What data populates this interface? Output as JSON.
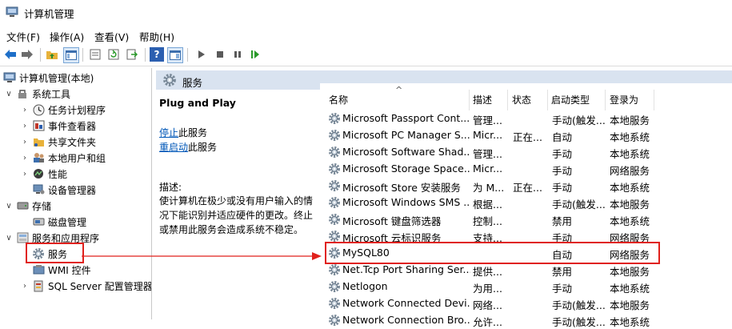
{
  "window": {
    "title": "计算机管理"
  },
  "menu": [
    "文件(F)",
    "操作(A)",
    "查看(V)",
    "帮助(H)"
  ],
  "toolbar_icons": [
    "back-icon",
    "forward-icon",
    "up-folder-icon",
    "show-hide-tree-icon",
    "export-list-icon",
    "refresh-icon",
    "export-icon",
    "help-icon",
    "properties-icon",
    "play-icon",
    "stop-icon",
    "pause-icon",
    "restart-icon"
  ],
  "tree": {
    "root": "计算机管理(本地)",
    "system_tools": "系统工具",
    "task_scheduler": "任务计划程序",
    "event_viewer": "事件查看器",
    "shared_folders": "共享文件夹",
    "local_users": "本地用户和组",
    "performance": "性能",
    "device_manager": "设备管理器",
    "storage": "存储",
    "disk_management": "磁盘管理",
    "services_apps": "服务和应用程序",
    "services": "服务",
    "wmi": "WMI 控件",
    "sql_server": "SQL Server 配置管理器"
  },
  "panel": {
    "title": "服务"
  },
  "extended": {
    "service_name": "Plug and Play",
    "stop_link": "停止",
    "stop_suffix": "此服务",
    "restart_link": "重启动",
    "restart_suffix": "此服务",
    "desc_label": "描述:",
    "desc_line1": "使计算机在极少或没有用户输入的情",
    "desc_line2": "况下能识别并适应硬件的更改。终止",
    "desc_line3": "或禁用此服务会造成系统不稳定。"
  },
  "columns": {
    "name": "名称",
    "desc": "描述",
    "status": "状态",
    "startup": "启动类型",
    "logon": "登录为"
  },
  "services": [
    {
      "name": "Microsoft Passport Cont...",
      "desc": "管理...",
      "status": "",
      "startup": "手动(触发...",
      "logon": "本地服务"
    },
    {
      "name": "Microsoft PC Manager S...",
      "desc": "Micr...",
      "status": "正在...",
      "startup": "自动",
      "logon": "本地系统"
    },
    {
      "name": "Microsoft Software Shad...",
      "desc": "管理...",
      "status": "",
      "startup": "手动",
      "logon": "本地系统"
    },
    {
      "name": "Microsoft Storage Space...",
      "desc": "Micr...",
      "status": "",
      "startup": "手动",
      "logon": "网络服务"
    },
    {
      "name": "Microsoft Store 安装服务",
      "desc": "为 M...",
      "status": "正在...",
      "startup": "手动",
      "logon": "本地系统"
    },
    {
      "name": "Microsoft Windows SMS ...",
      "desc": "根据...",
      "status": "",
      "startup": "手动(触发...",
      "logon": "本地服务"
    },
    {
      "name": "Microsoft 键盘筛选器",
      "desc": "控制...",
      "status": "",
      "startup": "禁用",
      "logon": "本地系统"
    },
    {
      "name": "Microsoft 云标识服务",
      "desc": "支持...",
      "status": "",
      "startup": "手动",
      "logon": "网络服务"
    },
    {
      "name": "MySQL80",
      "desc": "",
      "status": "",
      "startup": "自动",
      "logon": "网络服务"
    },
    {
      "name": "Net.Tcp Port Sharing Ser...",
      "desc": "提供...",
      "status": "",
      "startup": "禁用",
      "logon": "本地服务"
    },
    {
      "name": "Netlogon",
      "desc": "为用...",
      "status": "",
      "startup": "手动",
      "logon": "本地系统"
    },
    {
      "name": "Network Connected Devi...",
      "desc": "网络...",
      "status": "",
      "startup": "手动(触发...",
      "logon": "本地服务"
    },
    {
      "name": "Network Connection Bro...",
      "desc": "允许...",
      "status": "",
      "startup": "手动(触发...",
      "logon": "本地系统"
    }
  ],
  "colors": {
    "accent_red": "#e0211c",
    "header_bg": "#d9e3f0",
    "link": "#0057b8"
  }
}
